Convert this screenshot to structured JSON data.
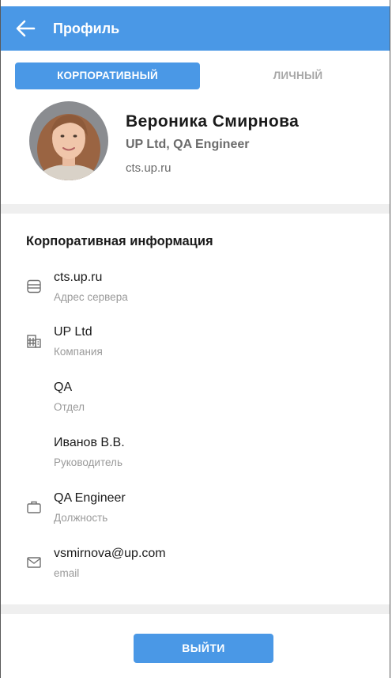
{
  "header": {
    "title": "Профиль",
    "back_icon": "arrow-left-icon"
  },
  "tabs": [
    {
      "label": "КОРПОРАТИВНЫЙ",
      "active": true
    },
    {
      "label": "ЛИЧНЫЙ",
      "active": false
    }
  ],
  "profile": {
    "name": "Вероника Смирнова",
    "job": "UP Ltd, QA Engineer",
    "server": "cts.up.ru"
  },
  "section": {
    "title": "Корпоративная информация"
  },
  "fields": [
    {
      "value": "cts.up.ru",
      "label": "Адрес сервера",
      "icon": "server-icon"
    },
    {
      "value": "UP Ltd",
      "label": "Компания",
      "icon": "building-icon"
    },
    {
      "value": "QA",
      "label": "Отдел",
      "icon": ""
    },
    {
      "value": "Иванов В.В.",
      "label": "Руководитель",
      "icon": ""
    },
    {
      "value": "QA Engineer",
      "label": "Должность",
      "icon": "briefcase-icon"
    },
    {
      "value": "vsmirnova@up.com",
      "label": "email",
      "icon": "mail-icon"
    }
  ],
  "actions": {
    "logout_label": "ВЫЙТИ"
  },
  "colors": {
    "accent": "#4a98e6",
    "muted": "#9a9a9a",
    "divider": "#efefef"
  }
}
